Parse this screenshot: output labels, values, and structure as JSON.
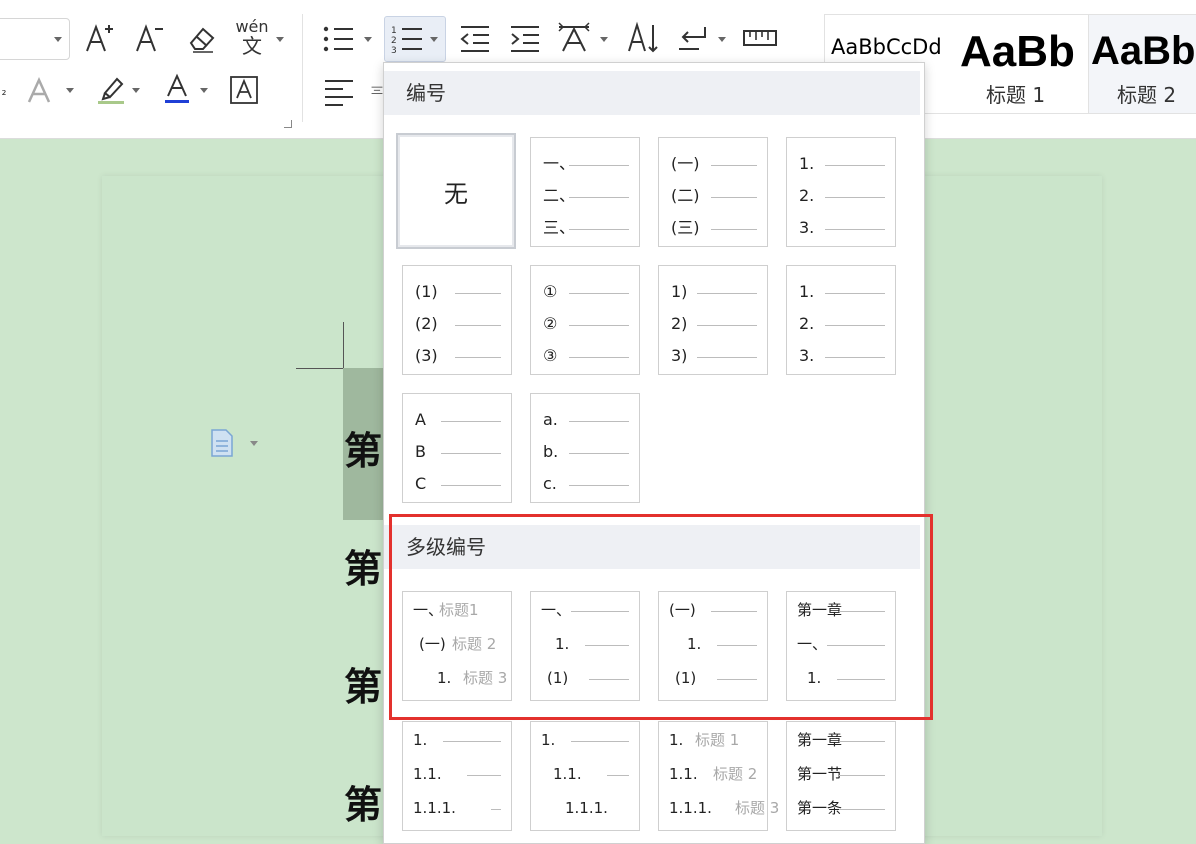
{
  "toolbar": {
    "pinyin_label": "wén",
    "style_gallery": [
      {
        "preview": "AaBbCcDd",
        "label": ""
      },
      {
        "preview": "AaBb",
        "label": "标题 1"
      },
      {
        "preview": "AaBb",
        "label": "标题 2"
      }
    ]
  },
  "document": {
    "heading_char": "第"
  },
  "numbering_panel": {
    "numbering_title": "编号",
    "none_label": "无",
    "single_level": [
      [
        "一、",
        "二、",
        "三、"
      ],
      [
        "(一)",
        "(二)",
        "(三)"
      ],
      [
        "1.",
        "2.",
        "3."
      ],
      [
        "(1)",
        "(2)",
        "(3)"
      ],
      [
        "①",
        "②",
        "③"
      ],
      [
        "1)",
        "2)",
        "3)"
      ],
      [
        "1.",
        "2.",
        "3."
      ],
      [
        "A",
        "B",
        "C"
      ],
      [
        "a.",
        "b.",
        "c."
      ]
    ],
    "multilevel_title": "多级编号",
    "multilevel": [
      [
        {
          "num": "一、",
          "text": "标题1"
        },
        {
          "num": "(一)",
          "text": "标题 2"
        },
        {
          "num": "1.",
          "text": "标题 3"
        }
      ],
      [
        {
          "num": "一、",
          "text": ""
        },
        {
          "num": "1.",
          "text": ""
        },
        {
          "num": "(1)",
          "text": ""
        }
      ],
      [
        {
          "num": "(一)",
          "text": ""
        },
        {
          "num": "1.",
          "text": ""
        },
        {
          "num": "(1)",
          "text": ""
        }
      ],
      [
        {
          "num": "第一章",
          "text": ""
        },
        {
          "num": "一、",
          "text": ""
        },
        {
          "num": "1.",
          "text": ""
        }
      ],
      [
        {
          "num": "1.",
          "text": ""
        },
        {
          "num": "1.1.",
          "text": ""
        },
        {
          "num": "1.1.1.",
          "text": ""
        }
      ],
      [
        {
          "num": "1.",
          "text": ""
        },
        {
          "num": "1.1.",
          "text": ""
        },
        {
          "num": "1.1.1.",
          "text": ""
        }
      ],
      [
        {
          "num": "1.",
          "text": "标题 1"
        },
        {
          "num": "1.1.",
          "text": "标题 2"
        },
        {
          "num": "1.1.1.",
          "text": "标题 3"
        }
      ],
      [
        {
          "num": "第一章",
          "text": ""
        },
        {
          "num": "第一节",
          "text": ""
        },
        {
          "num": "第一条",
          "text": ""
        }
      ]
    ]
  },
  "colors": {
    "document_background": "#cde6cc",
    "highlight_border": "#e3312d",
    "font_color_underline": "#1f3fd6"
  }
}
